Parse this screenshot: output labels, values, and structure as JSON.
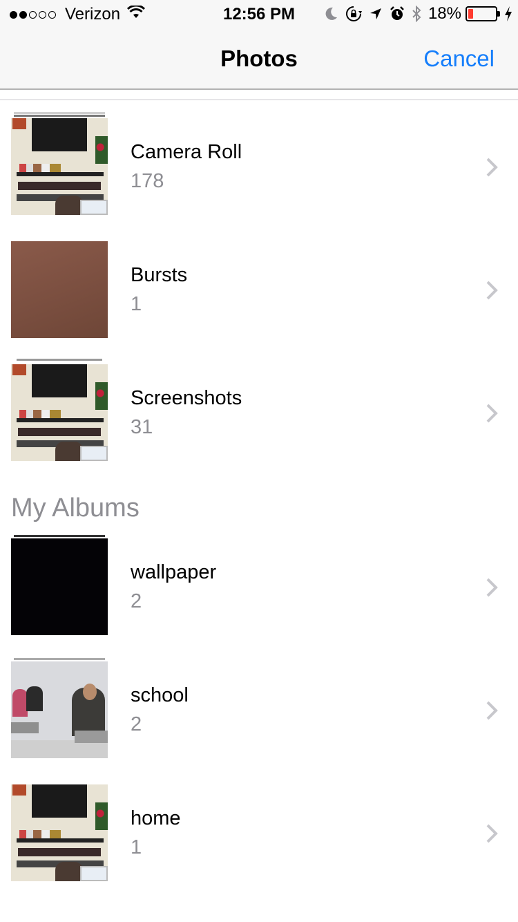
{
  "status_bar": {
    "carrier": "Verizon",
    "time": "12:56 PM",
    "battery_percent": "18%",
    "battery_level": 0.18,
    "signal_bars_filled": 2,
    "signal_bars_total": 5,
    "icons": [
      "wifi-icon",
      "moon-icon",
      "rotation-lock-icon",
      "location-arrow-icon",
      "alarm-icon",
      "bluetooth-icon",
      "charging-bolt-icon"
    ]
  },
  "nav": {
    "title": "Photos",
    "cancel_label": "Cancel"
  },
  "colors": {
    "accent": "#157efb",
    "secondary_text": "#8e8e93",
    "battery_low": "#ff3b30"
  },
  "albums": [
    {
      "name": "Camera Roll",
      "count": "178",
      "thumbnail": "room-photo"
    },
    {
      "name": "Bursts",
      "count": "1",
      "thumbnail": "brown-blur-photo"
    },
    {
      "name": "Screenshots",
      "count": "31",
      "thumbnail": "room-photo"
    }
  ],
  "my_albums": {
    "header": "My Albums",
    "items": [
      {
        "name": "wallpaper",
        "count": "2",
        "thumbnail": "black-photo"
      },
      {
        "name": "school",
        "count": "2",
        "thumbnail": "classroom-photo"
      },
      {
        "name": "home",
        "count": "1",
        "thumbnail": "room-photo"
      }
    ]
  }
}
